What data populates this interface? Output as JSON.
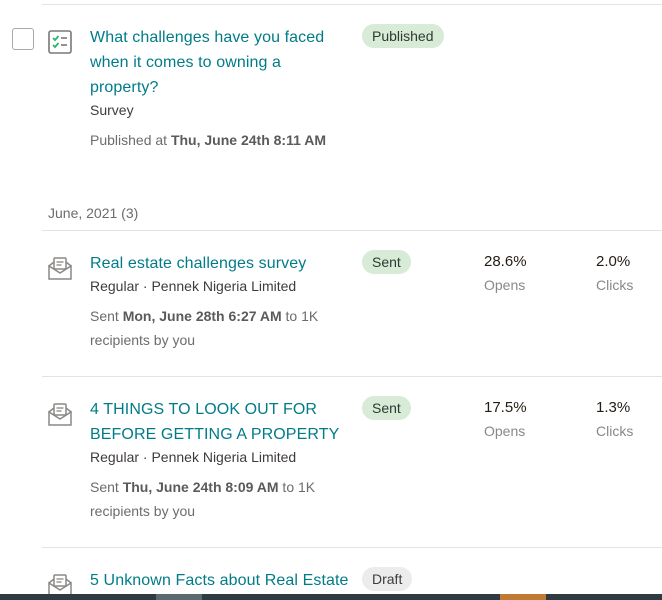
{
  "survey": {
    "title": "What challenges have you faced when it comes to owning a property?",
    "type": "Survey",
    "status": "Published",
    "published_prefix": "Published at ",
    "published_at": "Thu, June 24th 8:11 AM"
  },
  "group_header": "June, 2021 (3)",
  "campaigns": [
    {
      "title": "Real estate challenges survey",
      "type_audience": "Regular · Pennek Nigeria Limited",
      "status": "Sent",
      "sent_prefix": "Sent ",
      "sent_at": "Mon, June 28th 6:27 AM",
      "sent_suffix": " to 1K",
      "recipients": "recipients by you",
      "opens": "28.6%",
      "opens_label": "Opens",
      "clicks": "2.0%",
      "clicks_label": "Clicks"
    },
    {
      "title": "4 THINGS TO LOOK OUT FOR BEFORE GETTING A PROPERTY",
      "type_audience": "Regular · Pennek Nigeria Limited",
      "status": "Sent",
      "sent_prefix": "Sent ",
      "sent_at": "Thu, June 24th 8:09 AM",
      "sent_suffix": " to 1K",
      "recipients": "recipients by you",
      "opens": "17.5%",
      "opens_label": "Opens",
      "clicks": "1.3%",
      "clicks_label": "Clicks"
    },
    {
      "title": "5 Unknown Facts about Real Estate",
      "status": "Draft"
    }
  ],
  "icons": {
    "survey": "survey-checklist-icon",
    "email": "email-envelope-icon"
  },
  "colors": {
    "link": "#007c89",
    "sent_badge": "#d8ebd6",
    "draft_badge": "#ececec"
  }
}
